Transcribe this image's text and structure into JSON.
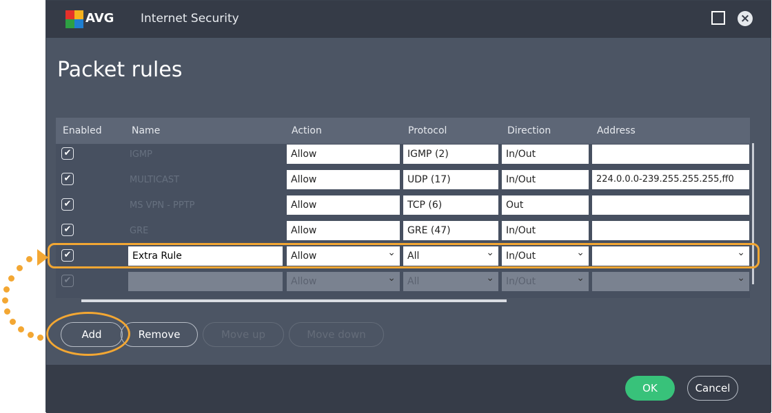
{
  "titlebar": {
    "logo_text": "AVG",
    "app_title": "Internet Security",
    "logo_colors": [
      "#e5312a",
      "#f6b21e",
      "#2ea043",
      "#1f7fd1"
    ]
  },
  "page": {
    "title": "Packet rules"
  },
  "table": {
    "columns": [
      "Enabled",
      "Name",
      "Action",
      "Protocol",
      "Direction",
      "Address"
    ],
    "rows": [
      {
        "enabled": "✔",
        "name": "IGMP",
        "action": "Allow",
        "protocol": "IGMP (2)",
        "direction": "In/Out",
        "address": ""
      },
      {
        "enabled": "✔",
        "name": "MULTICAST",
        "action": "Allow",
        "protocol": "UDP (17)",
        "direction": "In/Out",
        "address": "224.0.0.0-239.255.255.255,ff0"
      },
      {
        "enabled": "✔",
        "name": "MS VPN - PPTP",
        "action": "Allow",
        "protocol": "TCP (6)",
        "direction": "Out",
        "address": ""
      },
      {
        "enabled": "✔",
        "name": "GRE",
        "action": "Allow",
        "protocol": "GRE (47)",
        "direction": "In/Out",
        "address": ""
      },
      {
        "enabled": "✔",
        "name": "Extra Rule",
        "action": "Allow",
        "protocol": "All",
        "direction": "In/Out",
        "address": ""
      },
      {
        "enabled": "✔",
        "name": "",
        "action": "Allow",
        "protocol": "All",
        "direction": "In/Out",
        "address": ""
      }
    ]
  },
  "buttons": {
    "add": "Add",
    "remove": "Remove",
    "move_up": "Move up",
    "move_down": "Move down",
    "ok": "OK",
    "cancel": "Cancel"
  },
  "colors": {
    "accent_highlight": "#f3a733",
    "ok_green": "#38c27a",
    "window_bg": "#4c5564",
    "titlebar_bg": "#353b47"
  }
}
